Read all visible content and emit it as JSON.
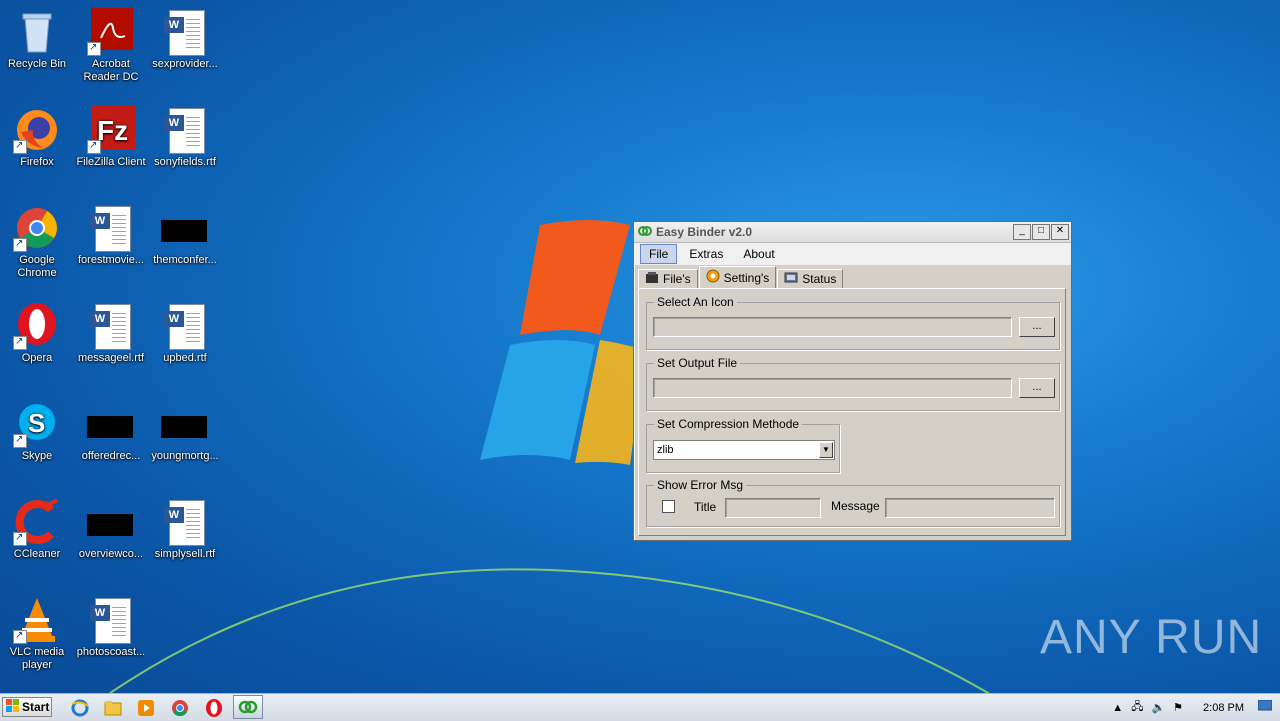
{
  "desktop": {
    "icons": [
      {
        "label": "Recycle Bin"
      },
      {
        "label": "Acrobat Reader DC"
      },
      {
        "label": "sexprovider..."
      },
      {
        "label": "Firefox"
      },
      {
        "label": "FileZilla Client"
      },
      {
        "label": "sonyfields.rtf"
      },
      {
        "label": "Google Chrome"
      },
      {
        "label": "forestmovie..."
      },
      {
        "label": "themconfer..."
      },
      {
        "label": "Opera"
      },
      {
        "label": "messageel.rtf"
      },
      {
        "label": "upbed.rtf"
      },
      {
        "label": "Skype"
      },
      {
        "label": "offeredrec..."
      },
      {
        "label": "youngmortg..."
      },
      {
        "label": "CCleaner"
      },
      {
        "label": "overviewco..."
      },
      {
        "label": "simplysell.rtf"
      },
      {
        "label": "VLC media player"
      },
      {
        "label": "photoscoast..."
      }
    ],
    "watermark": "ANY RUN"
  },
  "window": {
    "title": "Easy Binder v2.0",
    "menu": [
      "File",
      "Extras",
      "About"
    ],
    "tabs": [
      "File's",
      "Setting's",
      "Status"
    ],
    "groups": {
      "icon": {
        "legend": "Select An Icon",
        "browse": "..."
      },
      "output": {
        "legend": "Set Output File",
        "browse": "..."
      },
      "compression": {
        "legend": "Set Compression Methode",
        "selected": "zlib"
      },
      "error": {
        "legend": "Show Error Msg",
        "title_label": "Title",
        "message_label": "Message"
      }
    }
  },
  "taskbar": {
    "start_label": "Start",
    "clock": "2:08 PM"
  }
}
